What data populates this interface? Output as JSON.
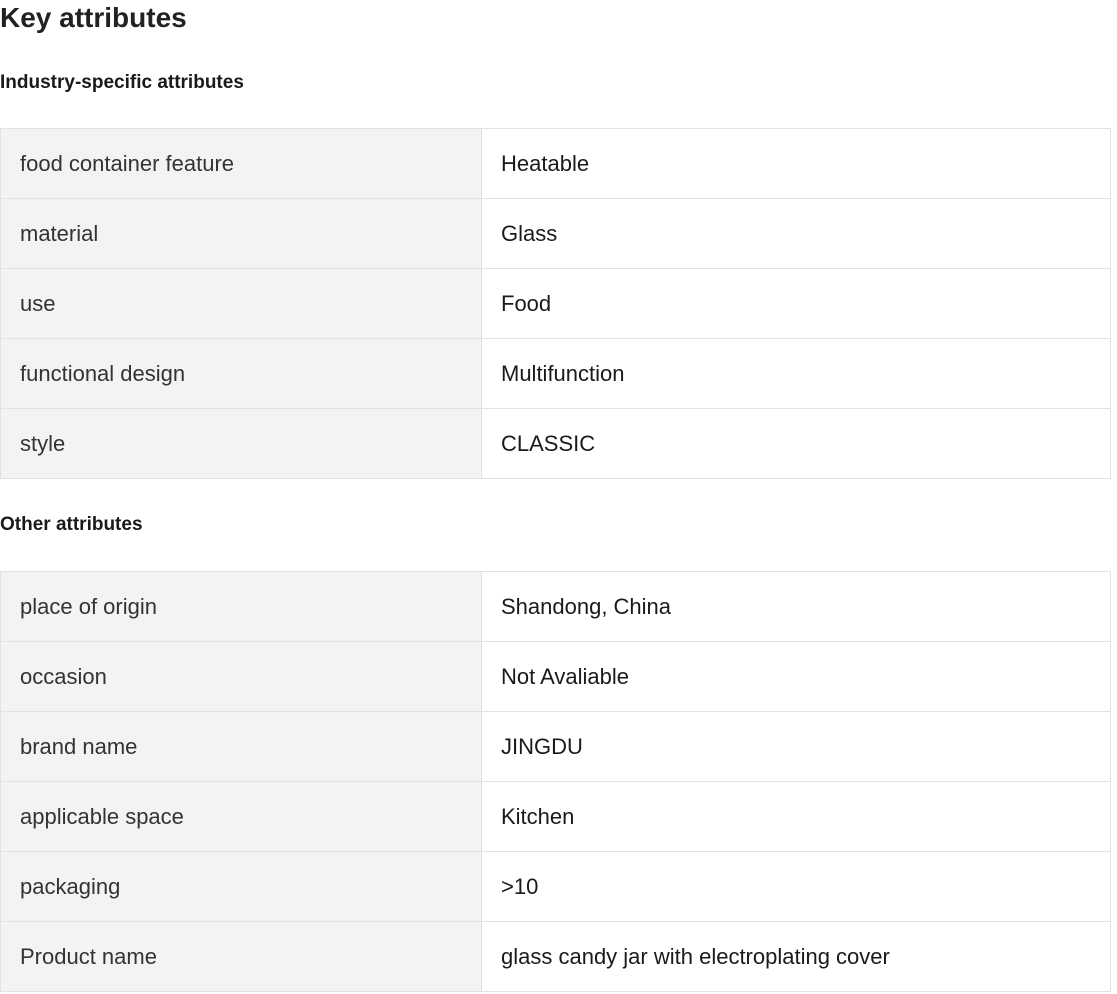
{
  "page": {
    "title": "Key attributes"
  },
  "sections": [
    {
      "title": "Industry-specific attributes",
      "rows": [
        {
          "name": "food container feature",
          "value": "Heatable"
        },
        {
          "name": "material",
          "value": "Glass"
        },
        {
          "name": "use",
          "value": "Food"
        },
        {
          "name": "functional design",
          "value": "Multifunction"
        },
        {
          "name": "style",
          "value": "CLASSIC"
        }
      ]
    },
    {
      "title": "Other attributes",
      "rows": [
        {
          "name": "place of origin",
          "value": "Shandong, China"
        },
        {
          "name": "occasion",
          "value": "Not Avaliable"
        },
        {
          "name": "brand name",
          "value": "JINGDU"
        },
        {
          "name": "applicable space",
          "value": "Kitchen"
        },
        {
          "name": "packaging",
          "value": ">10"
        },
        {
          "name": "Product name",
          "value": "glass candy jar with electroplating cover"
        }
      ]
    }
  ]
}
